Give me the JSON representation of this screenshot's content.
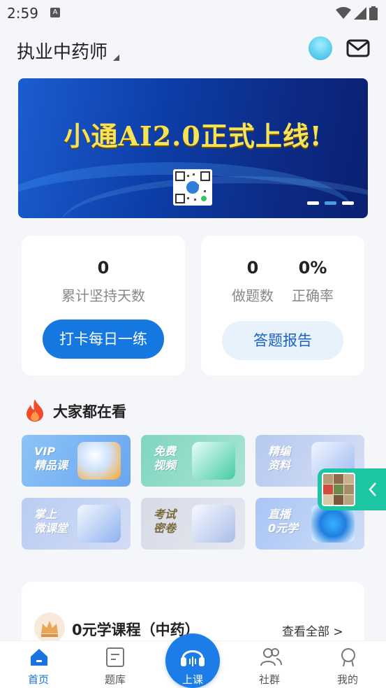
{
  "status_bar": {
    "time": "2:59",
    "notification_icon": "a-icon",
    "icons": [
      "wifi-icon",
      "signal-icon",
      "battery-icon"
    ]
  },
  "header": {
    "title": "执业中药师",
    "icons": [
      "avatar",
      "mail-icon"
    ]
  },
  "banner": {
    "headline": "小通AI2.0正式上线!",
    "slide_count": 3,
    "active_slide": 2
  },
  "stats": {
    "streak": {
      "value": "0",
      "label": "累计坚持天数",
      "button": "打卡每日一练"
    },
    "practice": {
      "count_value": "0",
      "count_label": "做题数",
      "rate_value": "0%",
      "rate_label": "正确率",
      "button": "答题报告"
    }
  },
  "trending": {
    "title": "大家都在看",
    "tiles": [
      {
        "label": "VIP 精品课"
      },
      {
        "label": "免费 视频"
      },
      {
        "label": "精编 资料"
      },
      {
        "label": "掌上 微课堂"
      },
      {
        "label": "考试 密卷"
      },
      {
        "label": "直播 0元学"
      }
    ]
  },
  "course_section": {
    "title": "0元学课程（中药）",
    "more": "查看全部 >"
  },
  "tabbar": {
    "items": [
      {
        "label": "首页",
        "icon": "home-icon",
        "active": true
      },
      {
        "label": "题库",
        "icon": "question-bank-icon",
        "active": false
      },
      {
        "label": "上课",
        "icon": "headphones-icon",
        "active": false
      },
      {
        "label": "社群",
        "icon": "community-icon",
        "active": false
      },
      {
        "label": "我的",
        "icon": "profile-icon",
        "active": false
      }
    ]
  },
  "colors": {
    "primary": "#1478e0",
    "accent_green": "#1cc6a2",
    "banner_text": "#f6e35a"
  }
}
